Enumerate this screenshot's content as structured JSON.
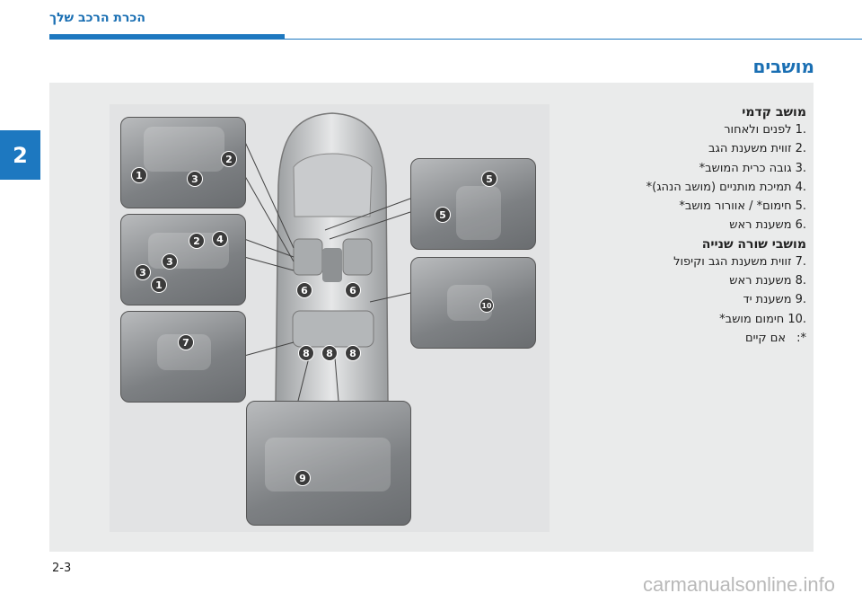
{
  "header": {
    "title": "הכרת הרכב שלך"
  },
  "chapter": {
    "number": "2"
  },
  "section": {
    "title": "מושבים"
  },
  "front_seats": {
    "title": "מושב קדמי",
    "items": [
      {
        "num": ".1",
        "text": "לפנים ולאחור"
      },
      {
        "num": ".2",
        "text": "זווית משענת הגב"
      },
      {
        "num": ".3",
        "text": "גובה כרית המושב*"
      },
      {
        "num": ".4",
        "text": "תמיכת מותניים (מושב הנהג)*"
      },
      {
        "num": ".5",
        "text": "חימום* / אוורור מושב*"
      },
      {
        "num": ".6",
        "text": "משענת ראש"
      }
    ]
  },
  "rear_seats": {
    "title": "מושבי שורה שנייה",
    "items": [
      {
        "num": ".7",
        "text": "זווית משענת הגב וקיפול"
      },
      {
        "num": ".8",
        "text": "משענת ראש"
      },
      {
        "num": ".9",
        "text": "משענת יד"
      },
      {
        "num": ".10",
        "text": "חימום מושב*"
      }
    ]
  },
  "footnote": {
    "mark": "*:",
    "text": "אם קיים"
  },
  "illustration": {
    "callouts": {
      "seat_side_1": "1",
      "seat_side_2": "2",
      "seat_side_3": "3",
      "seat_panel_1": "1",
      "seat_panel_2": "2",
      "seat_panel_3a": "3",
      "seat_panel_3b": "3",
      "seat_panel_4": "4",
      "rear_7": "7",
      "console_5a": "5",
      "console_5b": "5",
      "rear_switch_10": "10",
      "armrest_9": "9",
      "car_6a": "6",
      "car_6b": "6",
      "car_8a": "8",
      "car_8b": "8",
      "car_8c": "8"
    }
  },
  "footer": {
    "page": "2-3",
    "watermark": "carmanualsonline.info"
  },
  "colors": {
    "accent": "#1d78c0",
    "panel": "#eaebeb"
  }
}
